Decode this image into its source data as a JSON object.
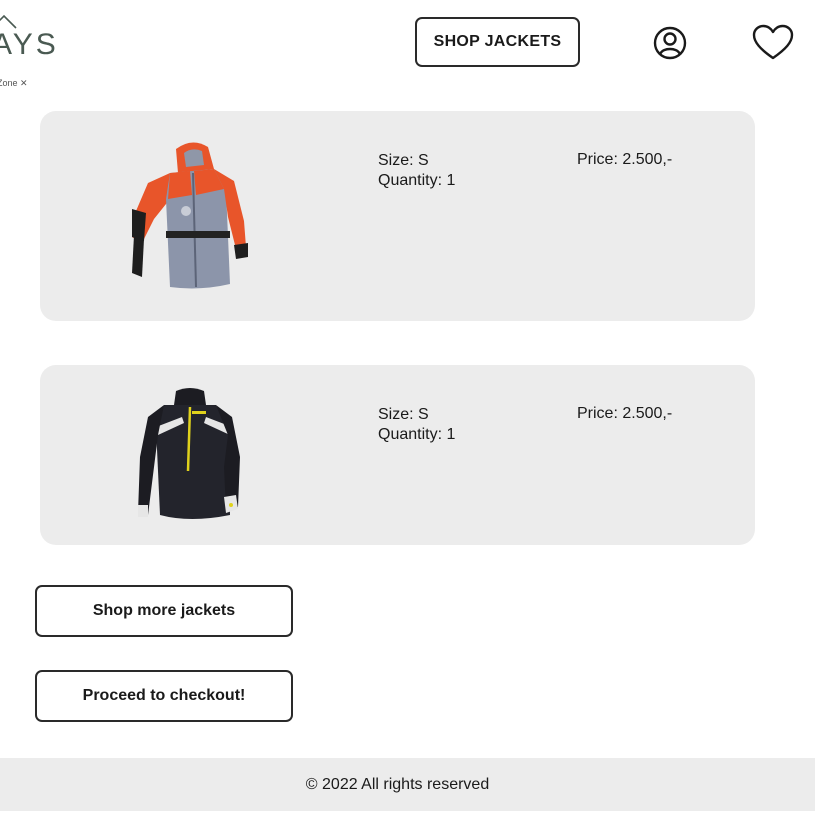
{
  "header": {
    "logo_text": "AYS",
    "logo_sub": "t Zone ✕",
    "shop_jackets_label": "SHOP JACKETS"
  },
  "cart": {
    "items": [
      {
        "size": "Size: S",
        "quantity": "Quantity: 1",
        "price": "Price: 2.500,-",
        "image": "orange-grey-jacket"
      },
      {
        "size": "Size: S",
        "quantity": "Quantity: 1",
        "price": "Price: 2.500,-",
        "image": "black-jacket"
      }
    ]
  },
  "actions": {
    "shop_more_label": "Shop more jackets",
    "checkout_label": "Proceed to checkout!"
  },
  "footer": {
    "copyright": "© 2022 All rights reserved"
  },
  "colors": {
    "card_bg": "#ececec",
    "logo": "#4a5a52",
    "border": "#2a2a2a"
  }
}
